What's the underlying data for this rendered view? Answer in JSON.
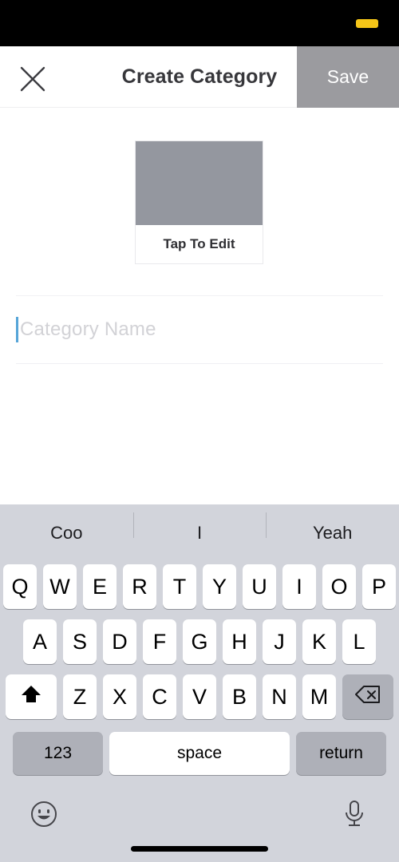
{
  "status_bar": {
    "indicator_color": "#f5c518",
    "background": "#000000"
  },
  "nav": {
    "close_icon": "close-x-icon",
    "title": "Create Category",
    "save_label": "Save",
    "save_bg": "#9b9b9f"
  },
  "form": {
    "image_picker": {
      "caption": "Tap To Edit",
      "thumb_color": "#94979f"
    },
    "category_field": {
      "value": "",
      "placeholder": "Category Name",
      "caret_color": "#56a5d8",
      "focused": true
    }
  },
  "keyboard": {
    "background": "#d2d4db",
    "suggestions": [
      "Coo",
      "I",
      "Yeah"
    ],
    "row1": [
      "Q",
      "W",
      "E",
      "R",
      "T",
      "Y",
      "U",
      "I",
      "O",
      "P"
    ],
    "row2": [
      "A",
      "S",
      "D",
      "F",
      "G",
      "H",
      "J",
      "K",
      "L"
    ],
    "row3": [
      "Z",
      "X",
      "C",
      "V",
      "B",
      "N",
      "M"
    ],
    "shift_icon": "shift-arrow-icon",
    "backspace_icon": "backspace-delete-icon",
    "numeric_label": "123",
    "space_label": "space",
    "return_label": "return",
    "emoji_icon": "emoji-smiley-icon",
    "mic_icon": "microphone-icon",
    "shift_active": true
  }
}
